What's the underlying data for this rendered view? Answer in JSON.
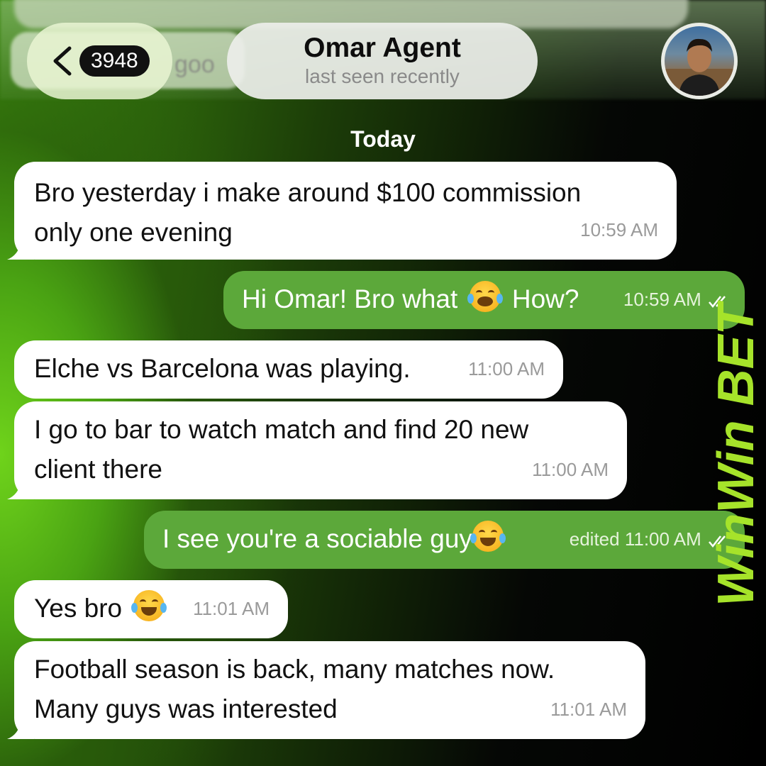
{
  "header": {
    "back_badge": "3948",
    "blurred_preview": "goo",
    "chat_name": "Omar Agent",
    "chat_status": "last seen recently",
    "avatar_icon": "user-avatar-photo"
  },
  "date_divider": "Today",
  "messages": [
    {
      "direction": "in",
      "text_line1": "Bro yesterday i make around $100 commission",
      "text_line2": "only one evening",
      "time": "10:59 AM"
    },
    {
      "direction": "out",
      "text_before_emoji": "Hi Omar! Bro what",
      "emoji": "loudly-crying-face-emoji",
      "text_after_emoji": "How?",
      "time": "10:59 AM",
      "status_icon": "double-check-icon"
    },
    {
      "direction": "in",
      "text": "Elche vs Barcelona was playing.",
      "time": "11:00 AM"
    },
    {
      "direction": "in",
      "text_line1": "I go to bar to watch match and find 20 new",
      "text_line2": "client there",
      "time": "11:00 AM"
    },
    {
      "direction": "out",
      "text": "I see you're a sociable guy",
      "emoji": "tears-of-joy-emoji",
      "time": "edited 11:00 AM",
      "status_icon": "double-check-icon"
    },
    {
      "direction": "in",
      "text": "Yes bro",
      "emoji": "tears-of-joy-emoji",
      "time": "11:01 AM"
    },
    {
      "direction": "in",
      "text_line1": "Football season is back, many matches now.",
      "text_line2": "Many guys was interested",
      "time": "11:01 AM"
    }
  ],
  "watermark": {
    "brand": "WinWin BET",
    "color": "#a6e32a"
  },
  "colors": {
    "outgoing_bubble": "#5ca83a",
    "incoming_bubble": "#ffffff",
    "brand_green": "#a6e32a"
  }
}
